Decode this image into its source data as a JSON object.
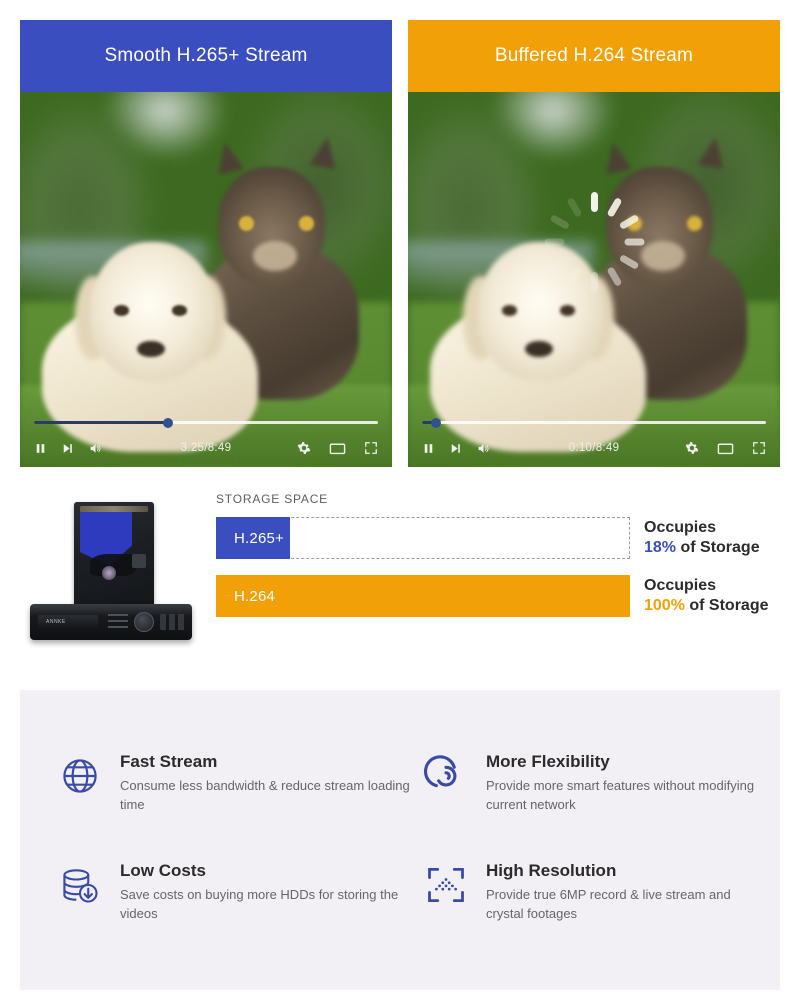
{
  "videos": [
    {
      "header": "Smooth H.265+ Stream",
      "header_color": "#3b4ec0",
      "state": "playing",
      "time_current": "3.25",
      "time_total": "8:49",
      "time_display": "3.25/8:49",
      "progress_percent": 39,
      "controls": {
        "pause": "pause-icon",
        "next": "next-track-icon",
        "volume": "volume-icon",
        "settings": "gear-icon",
        "theater": "theater-mode-icon",
        "fullscreen": "fullscreen-icon"
      }
    },
    {
      "header": "Buffered H.264 Stream",
      "header_color": "#f2a007",
      "state": "buffering",
      "time_current": "0:10",
      "time_total": "8:49",
      "time_display": "0:10/8:49",
      "progress_percent": 4,
      "controls": {
        "pause": "pause-icon",
        "next": "next-track-icon",
        "volume": "volume-icon",
        "settings": "gear-icon",
        "theater": "theater-mode-icon",
        "fullscreen": "fullscreen-icon"
      }
    }
  ],
  "storage": {
    "section_label": "STORAGE SPACE",
    "device_alt": "hard-drive-and-nvr",
    "bars": [
      {
        "codec": "H.265+",
        "percent": 18,
        "color": "#3b4ec0",
        "occupies_line1": "Occupies",
        "percent_text": "18%",
        "occupies_line2_suffix": " of Storage"
      },
      {
        "codec": "H.264",
        "percent": 100,
        "color": "#f2a007",
        "occupies_line1": "Occupies",
        "percent_text": "100%",
        "occupies_line2_suffix": " of Storage"
      }
    ]
  },
  "features": {
    "background_color": "#f2f0f5",
    "accent_color": "#3a4aa8",
    "items": [
      {
        "icon": "globe-icon",
        "title": "Fast Stream",
        "desc": "Consume less bandwidth & reduce stream loading time"
      },
      {
        "icon": "spiral-icon",
        "title": "More Flexibility",
        "desc": "Provide more smart features without modifying current network"
      },
      {
        "icon": "database-download-icon",
        "title": "Low Costs",
        "desc": "Save costs on buying more HDDs for storing the videos"
      },
      {
        "icon": "resolution-frame-icon",
        "title": "High Resolution",
        "desc": "Provide true 6MP record & live stream and crystal footages"
      }
    ]
  }
}
